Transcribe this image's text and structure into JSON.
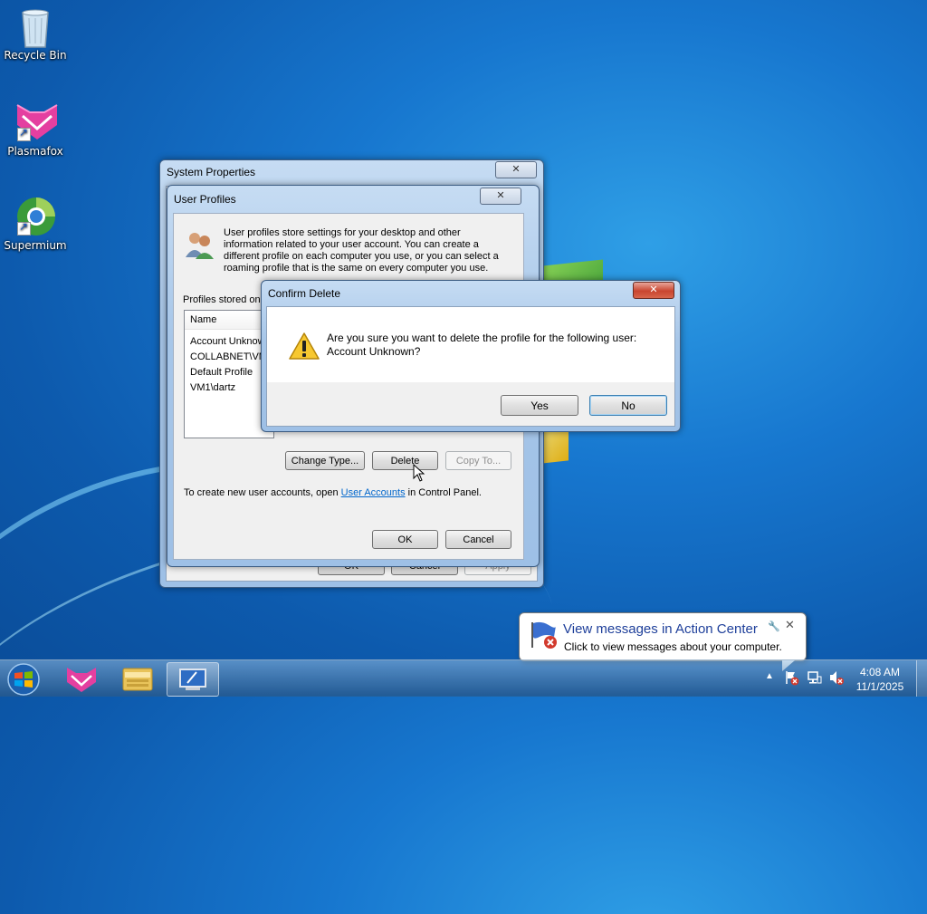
{
  "desktop": {
    "icons": [
      {
        "label": "Recycle Bin",
        "icon": "recycle-bin-icon"
      },
      {
        "label": "Plasmafox",
        "icon": "plasmafox-icon"
      },
      {
        "label": "Supermium",
        "icon": "supermium-icon"
      }
    ]
  },
  "system_properties": {
    "title": "System Properties",
    "buttons": {
      "ok": "OK",
      "cancel": "Cancel",
      "apply": "Apply"
    }
  },
  "user_profiles": {
    "title": "User Profiles",
    "description": "User profiles store settings for your desktop and other information related to your user account. You can create a different profile on each computer you use, or you can select a roaming profile that is the same on every computer you use.",
    "profiles_label": "Profiles stored on",
    "column_name": "Name",
    "profiles": [
      "Account Unknow",
      "COLLABNET\\VM",
      "Default Profile",
      "VM1\\dartz"
    ],
    "buttons": {
      "change_type": "Change Type...",
      "delete": "Delete",
      "copy_to": "Copy To...",
      "ok": "OK",
      "cancel": "Cancel"
    },
    "footer_text_before": "To create new user accounts, open ",
    "footer_link": "User Accounts",
    "footer_text_after": " in Control Panel."
  },
  "confirm_delete": {
    "title": "Confirm Delete",
    "message_line1": "Are you sure you want to delete the profile for the following user:",
    "message_line2": "Account Unknown?",
    "yes": "Yes",
    "no": "No"
  },
  "notification": {
    "title": "View messages in Action Center",
    "body": "Click to view messages about your computer."
  },
  "taskbar": {
    "time": "4:08 AM",
    "date": "11/1/2025"
  }
}
